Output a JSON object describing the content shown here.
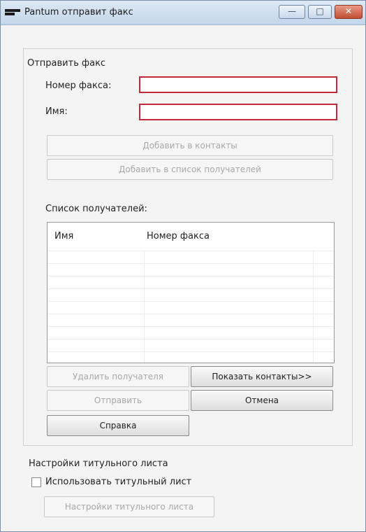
{
  "window": {
    "title": "Pantum отправит факс",
    "icon": "pantum-logo-icon",
    "buttons": {
      "minimize": "—",
      "maximize": "□",
      "close": "✕"
    }
  },
  "send_fax": {
    "group_label": "Отправить факс",
    "fax_number_label": "Номер факса:",
    "fax_number_value": "",
    "name_label": "Имя:",
    "name_value": "",
    "add_to_contacts": "Добавить в контакты",
    "add_to_recipients": "Добавить в список получателей"
  },
  "recipients": {
    "label": "Список получателей:",
    "columns": [
      "Имя",
      "Номер факса"
    ],
    "rows": []
  },
  "actions": {
    "remove_recipient": "Удалить получателя",
    "show_contacts": "Показать контакты>>",
    "send": "Отправить",
    "cancel": "Отмена",
    "help": "Справка"
  },
  "cover_page": {
    "group_label": "Настройки титульного листа",
    "use_cover_label": "Использовать титульный лист",
    "use_cover_checked": false,
    "settings_button": "Настройки титульного листа"
  },
  "colors": {
    "input_border": "#c4283c",
    "titlebar": "#c3d6ea",
    "close_button": "#c24e34",
    "disabled_text": "#a8a8a8"
  }
}
